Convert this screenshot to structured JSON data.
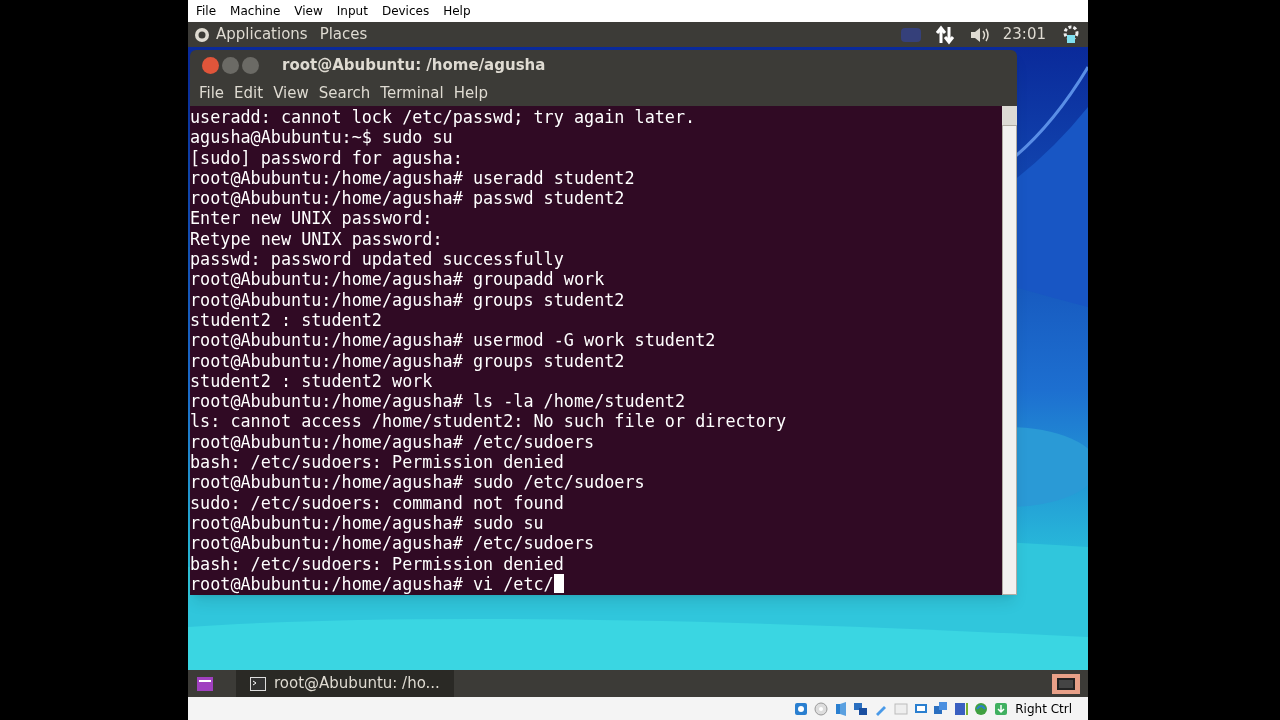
{
  "vm_menu": [
    "File",
    "Machine",
    "View",
    "Input",
    "Devices",
    "Help"
  ],
  "top_panel": {
    "menus": [
      "Applications",
      "Places"
    ],
    "clock": "23:01"
  },
  "terminal": {
    "title": "root@Abubuntu: /home/agusha",
    "menu": [
      "File",
      "Edit",
      "View",
      "Search",
      "Terminal",
      "Help"
    ],
    "lines": [
      "useradd: cannot lock /etc/passwd; try again later.",
      "agusha@Abubuntu:~$ sudo su",
      "[sudo] password for agusha:",
      "root@Abubuntu:/home/agusha# useradd student2",
      "root@Abubuntu:/home/agusha# passwd student2",
      "Enter new UNIX password:",
      "Retype new UNIX password:",
      "passwd: password updated successfully",
      "root@Abubuntu:/home/agusha# groupadd work",
      "root@Abubuntu:/home/agusha# groups student2",
      "student2 : student2",
      "root@Abubuntu:/home/agusha# usermod -G work student2",
      "root@Abubuntu:/home/agusha# groups student2",
      "student2 : student2 work",
      "root@Abubuntu:/home/agusha# ls -la /home/student2",
      "ls: cannot access /home/student2: No such file or directory",
      "root@Abubuntu:/home/agusha# /etc/sudoers",
      "bash: /etc/sudoers: Permission denied",
      "root@Abubuntu:/home/agusha# sudo /etc/sudoers",
      "sudo: /etc/sudoers: command not found",
      "root@Abubuntu:/home/agusha# sudo su",
      "root@Abubuntu:/home/agusha# /etc/sudoers",
      "bash: /etc/sudoers: Permission denied",
      "root@Abubuntu:/home/agusha# vi /etc/"
    ],
    "cursor": true
  },
  "taskbar": {
    "window_button": {
      "label": "root@Abubuntu: /ho...",
      "selected": true
    }
  },
  "status_bar": {
    "host_key": "Right Ctrl"
  }
}
